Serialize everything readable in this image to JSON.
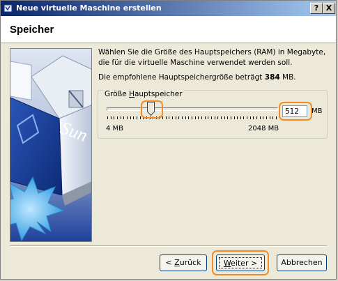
{
  "window": {
    "title": "Neue virtuelle Maschine erstellen",
    "help_label": "?",
    "close_label": "X"
  },
  "page": {
    "title": "Speicher",
    "description": "Wählen Sie die Größe des Hauptspeichers (RAM) in Megabyte, die für die virtuelle Maschine verwendet werden soll.",
    "recommended_prefix": "Die empfohlene Hauptspeichergröße beträgt",
    "recommended_value": "384",
    "recommended_unit": "MB."
  },
  "memory_group": {
    "legend_prefix": "Größe ",
    "legend_accel": "H",
    "legend_rest": "auptspeicher",
    "slider": {
      "min_label": "4 MB",
      "max_label": "2048 MB",
      "min": 4,
      "max": 2048,
      "value": 512
    },
    "value_text": "512",
    "unit": "MB"
  },
  "buttons": {
    "back_prefix": "< ",
    "back_accel": "Z",
    "back_rest": "urück",
    "next_accel": "W",
    "next_rest": "eiter >",
    "cancel": "Abbrechen"
  },
  "colors": {
    "highlight": "#f28c28",
    "titlebar_start": "#0a246a",
    "titlebar_end": "#a6caf0"
  },
  "icons": {
    "title": "virtualbox-icon",
    "art": "virtualbox-sun-cube"
  }
}
